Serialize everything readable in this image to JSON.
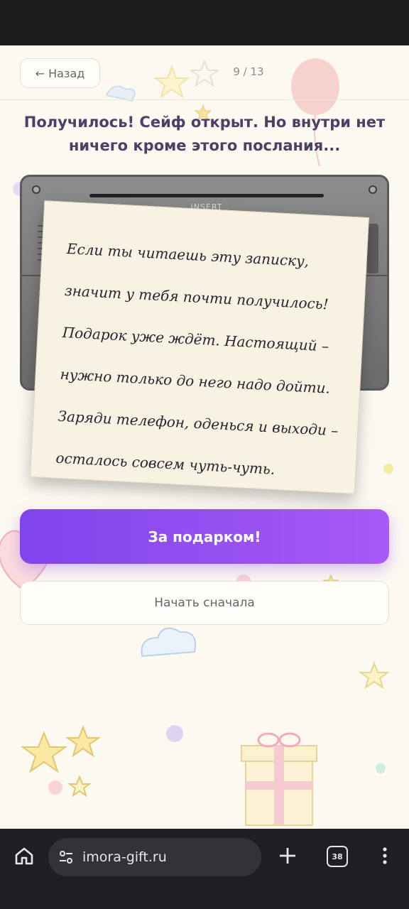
{
  "header": {
    "back_label": "← Назад",
    "progress": "9 / 13"
  },
  "title": "Получилось! Сейф открыт. Но внутри нет ничего кроме этого послания...",
  "safe": {
    "slot_label": "INSERT"
  },
  "note": {
    "lines": [
      "Если ты читаешь эту записку,",
      "значит у тебя почти получилось!",
      "Подарок уже ждёт. Настоящий –",
      "нужно только до него надо дойти.",
      "Заряди телефон, оденься и выходи –",
      "осталось совсем чуть-чуть."
    ]
  },
  "actions": {
    "primary_label": "За подарком!",
    "secondary_label": "Начать сначала"
  },
  "browser": {
    "url": "imora-gift.ru",
    "tab_count": "38"
  },
  "colors": {
    "accent": "#8b4ff0",
    "background": "#fcf9f1",
    "title": "#4b4066"
  }
}
